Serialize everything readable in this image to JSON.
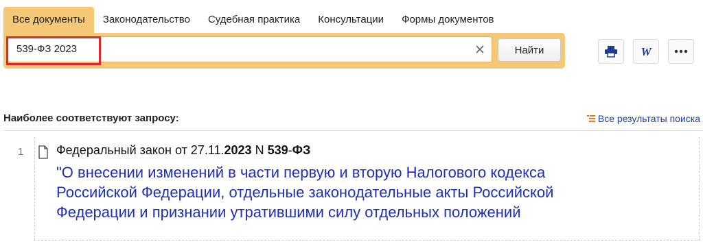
{
  "tabs": [
    {
      "label": "Все документы",
      "active": true
    },
    {
      "label": "Законодательство"
    },
    {
      "label": "Судебная практика"
    },
    {
      "label": "Консультации"
    },
    {
      "label": "Формы документов"
    }
  ],
  "search": {
    "value": "539-ФЗ 2023",
    "clear_icon": "close-icon",
    "find_label": "Найти"
  },
  "toolbar": {
    "print_icon": "printer-icon",
    "word_icon": "word-icon",
    "more_icon": "more-dots-icon"
  },
  "results": {
    "header": "Наиболее соответствуют запросу:",
    "all_results_label": "Все результаты поиска",
    "items": [
      {
        "number": "1",
        "title_prefix": "Федеральный закон от 27.11.",
        "title_year": "2023",
        "title_mid": " N ",
        "title_num": "539",
        "title_dash": "-",
        "title_fz": "ФЗ",
        "link": "\"О внесении изменений в части первую и вторую Налогового кодекса Российской Федерации, отдельные законодательные акты Российской Федерации и признании утратившими силу отдельных положений"
      }
    ]
  },
  "colors": {
    "accent": "#f5c877",
    "highlight": "#e3262d",
    "link": "#1f2fb8"
  }
}
